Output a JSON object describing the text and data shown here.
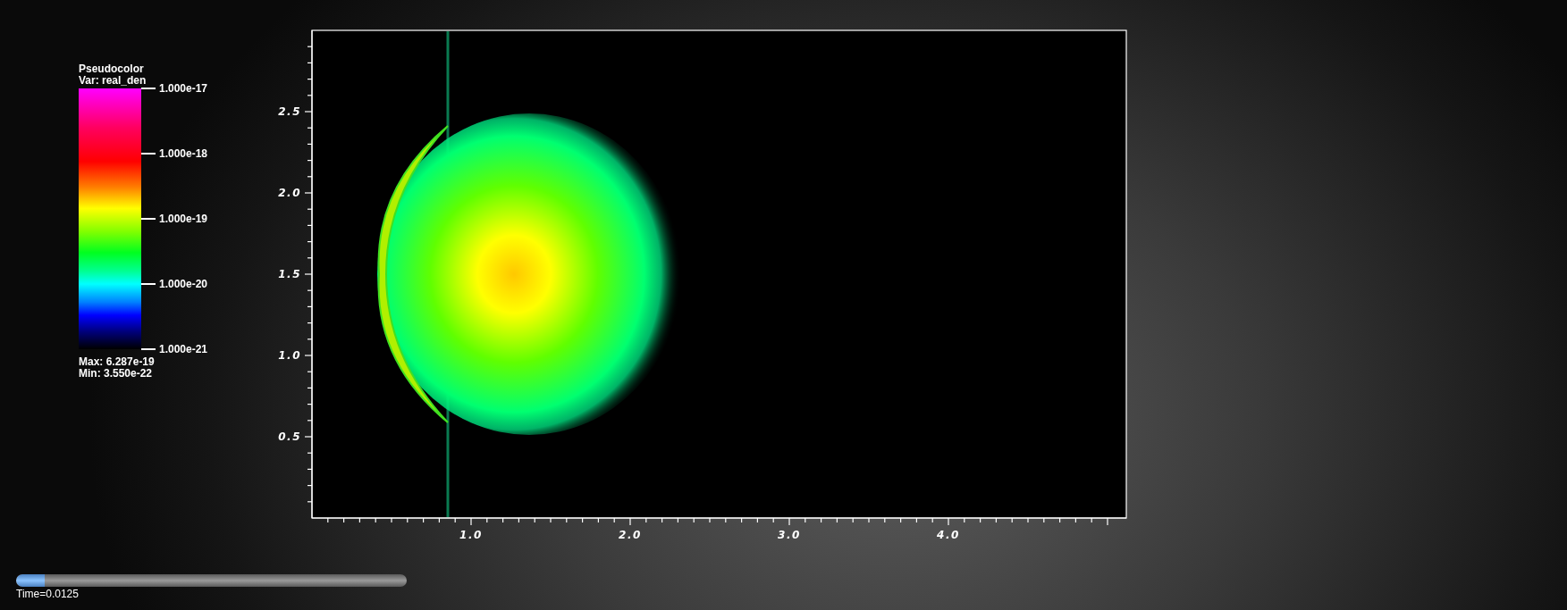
{
  "legend": {
    "title": "Pseudocolor",
    "variable": "Var: real_den",
    "tick_labels": [
      "1.000e-17",
      "1.000e-18",
      "1.000e-19",
      "1.000e-20",
      "1.000e-21"
    ],
    "max": "Max:  6.287e-19",
    "min": "Min:  3.550e-22"
  },
  "plot": {
    "x_tick_labels": [
      "1.0",
      "2.0",
      "3.0",
      "4.0"
    ],
    "y_tick_labels": [
      "2.5",
      "2.0",
      "1.5",
      "1.0",
      "0.5"
    ]
  },
  "time_slider": {
    "level": 0.073,
    "label": "Time=0.0125"
  }
}
